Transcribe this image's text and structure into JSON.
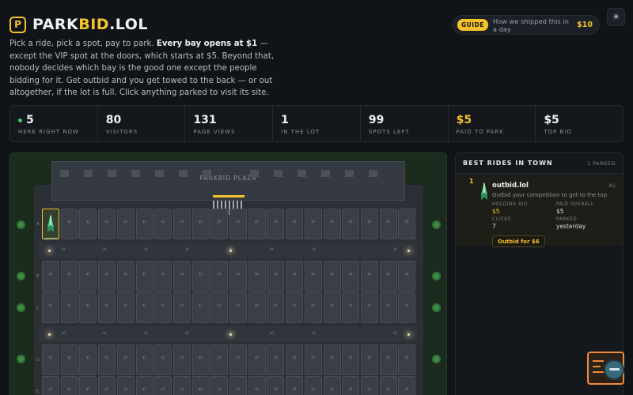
{
  "header": {
    "logo_mark": "P",
    "logo_part1": "PARK",
    "logo_part2": "BID",
    "logo_part3": ".LOL"
  },
  "intro": {
    "part1": "Pick a ride, pick a spot, pay to park. ",
    "bold": "Every bay opens at $1",
    "part2": " — except the VIP spot at the doors, which starts at $5. Beyond that, nobody decides which bay is the good one except the people bidding for it. Get outbid and you get towed to the back — or out altogether, if the lot is full. Click anything parked to visit its site."
  },
  "guide": {
    "badge": "GUIDE",
    "text": "How we shipped this in a day",
    "price": "$10"
  },
  "theme_toggle": {
    "icon": "sun-icon",
    "glyph": "☀"
  },
  "stats": [
    {
      "value": "5",
      "label": "HERE RIGHT NOW",
      "live": true
    },
    {
      "value": "80",
      "label": "VISITORS"
    },
    {
      "value": "131",
      "label": "PAGE VIEWS"
    },
    {
      "value": "1",
      "label": "IN THE LOT"
    },
    {
      "value": "99",
      "label": "SPOTS LEFT"
    },
    {
      "value": "$5",
      "label": "PAID TO PARK",
      "gold": true
    },
    {
      "value": "$5",
      "label": "TOP BID"
    }
  ],
  "lot": {
    "plaza_label": "PARKBID PLAZA",
    "row_letters": [
      "A",
      "B",
      "C",
      "D",
      "E"
    ],
    "bay_price": "$1",
    "vip_price": "$5",
    "occupied_label": "outbid.lol",
    "lane1_arrows": [
      ">",
      ">",
      ">",
      ">",
      ">",
      ">",
      ">",
      ">"
    ],
    "lane2_arrows": [
      "<",
      "<",
      "<",
      "<",
      "<",
      "<",
      "<",
      "<"
    ]
  },
  "sidebar": {
    "title": "BEST RIDES IN TOWN",
    "count": "1 PARKED",
    "entries": [
      {
        "rank": "1",
        "name": "outbid.lol",
        "id": "A1",
        "description": "Outbid your competition to get to the top",
        "holding_bid_label": "HOLDING BID",
        "holding_bid": "$5",
        "paid_overall_label": "PAID OVERALL",
        "paid_overall": "$5",
        "clicks_label": "CLICKS",
        "clicks": "7",
        "parked_label": "PARKED",
        "parked": "yesterday",
        "button": "Outbid for $6"
      }
    ]
  },
  "colors": {
    "accent": "#f4c22b",
    "background": "#101318",
    "live": "#3fcf6c",
    "grass": "#1b2b1e"
  }
}
